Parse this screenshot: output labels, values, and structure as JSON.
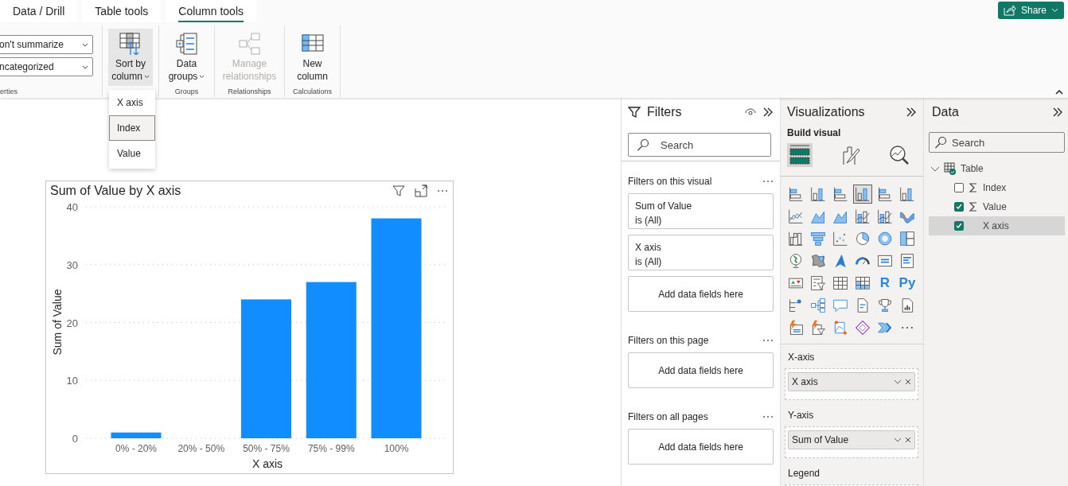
{
  "ribbon": {
    "tabs": [
      {
        "label": "Data / Drill",
        "selected": false
      },
      {
        "label": "Table tools",
        "selected": false
      },
      {
        "label": "Column tools",
        "selected": true
      }
    ],
    "share": {
      "label": "Share"
    },
    "properties_group": {
      "dropdowns": [
        "on't summarize",
        "ncategorized"
      ],
      "label": "erties"
    },
    "groups": [
      {
        "buttons": [
          {
            "kind": "sort",
            "label": "Sort by column",
            "dropdown": true,
            "pressed": true,
            "disabled": false
          }
        ]
      },
      {
        "label": "Groups",
        "buttons": [
          {
            "kind": "groups",
            "label": "Data groups",
            "dropdown": true,
            "pressed": false,
            "disabled": false
          }
        ]
      },
      {
        "label": "Relationships",
        "buttons": [
          {
            "kind": "relationships",
            "label": "Manage relationships",
            "dropdown": false,
            "pressed": false,
            "disabled": true
          }
        ]
      },
      {
        "label": "Calculations",
        "buttons": [
          {
            "kind": "newcolumn",
            "label": "New column",
            "dropdown": false,
            "pressed": false,
            "disabled": false
          }
        ]
      }
    ],
    "sort_menu": {
      "items": [
        {
          "label": "X axis",
          "selected": false
        },
        {
          "label": "Index",
          "selected": true
        },
        {
          "label": "Value",
          "selected": false
        }
      ]
    }
  },
  "canvas": {
    "visual": {
      "title": "Sum of Value by X axis",
      "chart_data": {
        "type": "bar",
        "xlabel": "X axis",
        "ylabel": "Sum of Value",
        "categories": [
          "0% - 20%",
          "20% - 50%",
          "50% - 75%",
          "75% - 99%",
          "100%"
        ],
        "series": [
          {
            "color": "#118dff",
            "values": [
              1,
              0,
              24,
              27,
              38
            ]
          }
        ],
        "grid": true,
        "ylim": [
          0,
          40
        ],
        "yticks": [
          0,
          10,
          20,
          30,
          40
        ]
      }
    }
  },
  "filters": {
    "title": "Filters",
    "search": {
      "placeholder": "Search"
    },
    "sections": [
      {
        "title": "Filters on this visual",
        "cards": [
          {
            "field": "Sum of Value",
            "condition": "is (All)"
          },
          {
            "field": "X axis",
            "condition": "is (All)"
          }
        ],
        "drop_hint": "Add data fields here"
      },
      {
        "title": "Filters on this page",
        "drop_hint": "Add data fields here"
      },
      {
        "title": "Filters on all pages",
        "drop_hint": "Add data fields here"
      }
    ]
  },
  "visualizations": {
    "title": "Visualizations",
    "subtitle": "Build visual",
    "modes": [
      {
        "kind": "build",
        "selected": true
      },
      {
        "kind": "format",
        "selected": false
      },
      {
        "kind": "analytics",
        "selected": false
      }
    ],
    "types": [
      {
        "kind": "hbar",
        "selected": false
      },
      {
        "kind": "vbar",
        "selected": false
      },
      {
        "kind": "hbar",
        "selected": false
      },
      {
        "kind": "vbar",
        "selected": true
      },
      {
        "kind": "hbar",
        "selected": false
      },
      {
        "kind": "vbar",
        "selected": false
      },
      {
        "kind": "line",
        "selected": false
      },
      {
        "kind": "area",
        "selected": false
      },
      {
        "kind": "area",
        "selected": false
      },
      {
        "kind": "combo",
        "selected": false
      },
      {
        "kind": "combo",
        "selected": false
      },
      {
        "kind": "ribbon",
        "selected": false
      },
      {
        "kind": "waterfall",
        "selected": false
      },
      {
        "kind": "funnel",
        "selected": false
      },
      {
        "kind": "scatter",
        "selected": false
      },
      {
        "kind": "pie",
        "selected": false
      },
      {
        "kind": "donut",
        "selected": false
      },
      {
        "kind": "treemap",
        "selected": false
      },
      {
        "kind": "globe",
        "selected": false
      },
      {
        "kind": "filledmap",
        "selected": false
      },
      {
        "kind": "arrow",
        "selected": false
      },
      {
        "kind": "gauge",
        "selected": false
      },
      {
        "kind": "card",
        "selected": false
      },
      {
        "kind": "list",
        "selected": false
      },
      {
        "kind": "kpi",
        "selected": false
      },
      {
        "kind": "slicer",
        "selected": false
      },
      {
        "kind": "table",
        "selected": false
      },
      {
        "kind": "matrix",
        "selected": false
      },
      {
        "kind": "letter",
        "label": "R",
        "selected": false
      },
      {
        "kind": "letter",
        "label": "Py",
        "selected": false
      },
      {
        "kind": "keyinf",
        "selected": false
      },
      {
        "kind": "tree",
        "selected": false
      },
      {
        "kind": "speech",
        "selected": false
      },
      {
        "kind": "doc",
        "selected": false
      },
      {
        "kind": "trophy",
        "selected": false
      },
      {
        "kind": "report",
        "selected": false
      },
      {
        "kind": "flashcard",
        "selected": false
      },
      {
        "kind": "flashslicer",
        "selected": false
      },
      {
        "kind": "shape",
        "selected": false
      },
      {
        "kind": "diamond",
        "selected": false
      },
      {
        "kind": "chevron",
        "selected": false
      },
      {
        "kind": "more",
        "selected": false
      }
    ],
    "wells": [
      {
        "label": "X-axis",
        "fields": [
          "X axis"
        ]
      },
      {
        "label": "Y-axis",
        "fields": [
          "Sum of Value"
        ]
      },
      {
        "label": "Legend"
      }
    ]
  },
  "data": {
    "title": "Data",
    "search": {
      "placeholder": "Search"
    },
    "tables": [
      {
        "name": "Table",
        "expanded": true,
        "fields": [
          {
            "name": "Index",
            "kind": "numeric",
            "checked": false,
            "selected": false
          },
          {
            "name": "Value",
            "kind": "numeric",
            "checked": true,
            "selected": false
          },
          {
            "name": "X axis",
            "kind": "text",
            "checked": true,
            "selected": true
          }
        ]
      }
    ]
  }
}
